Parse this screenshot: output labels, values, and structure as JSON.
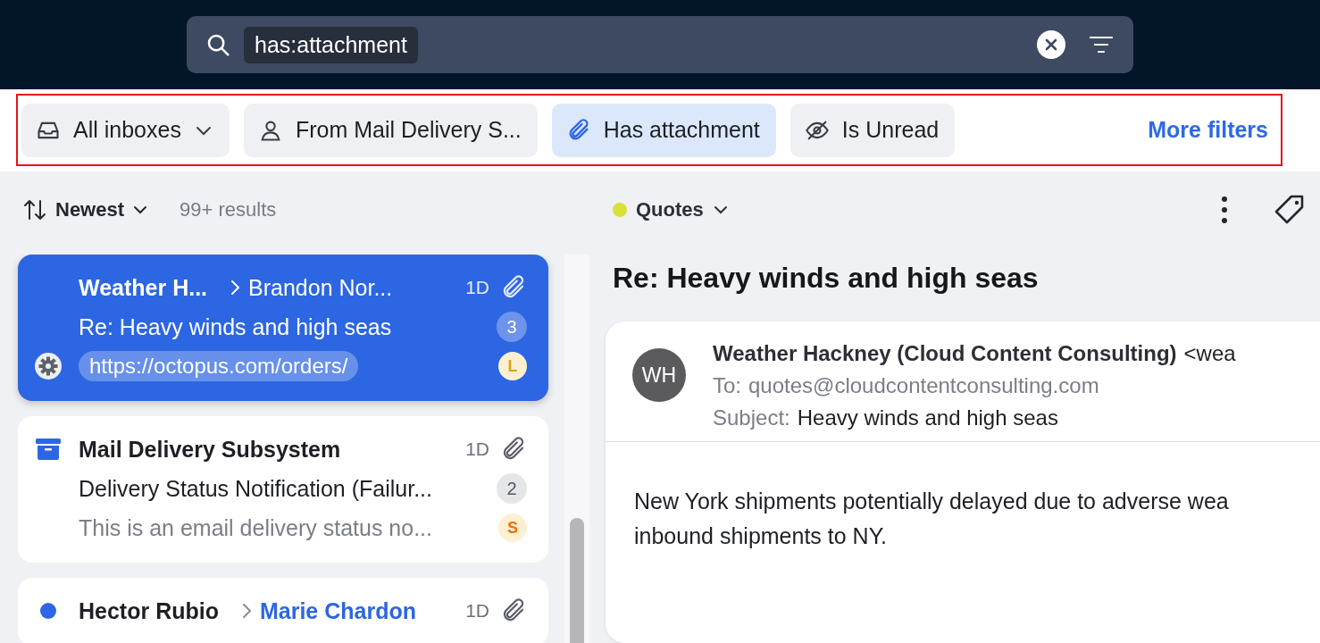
{
  "search": {
    "query": "has:attachment"
  },
  "filters": [
    {
      "label": "All inboxes",
      "selected": false,
      "dropdown": true
    },
    {
      "label": "From Mail Delivery S...",
      "selected": false,
      "dropdown": false
    },
    {
      "label": "Has attachment",
      "selected": true,
      "dropdown": false
    },
    {
      "label": "Is Unread",
      "selected": false,
      "dropdown": false
    }
  ],
  "more_filters": "More filters",
  "sort": {
    "label": "Newest",
    "results": "99+ results"
  },
  "messages": [
    {
      "kind": "automated",
      "selected": true,
      "sender": "Weather H...",
      "recipient": "Brandon Nor...",
      "recipient_highlight": false,
      "time": "1D",
      "attachment": true,
      "subject": "Re: Heavy winds and high seas",
      "count": "3",
      "link": "https://octopus.com/orders/",
      "avatar": "L",
      "color": "#d9a514"
    },
    {
      "kind": "archived",
      "selected": false,
      "sender": "Mail Delivery Subsystem",
      "time": "1D",
      "attachment": true,
      "subject": "Delivery Status Notification (Failur...",
      "count": "2",
      "preview": "This is an email delivery status no...",
      "avatar": "S",
      "color": "#e8730c"
    },
    {
      "kind": "unread",
      "selected": false,
      "sender": "Hector Rubio",
      "recipient": "Marie Chardon",
      "recipient_highlight": true,
      "time": "1D",
      "attachment": true
    }
  ],
  "detail": {
    "label": {
      "name": "Quotes",
      "color": "#d9e03a"
    },
    "title": "Re: Heavy winds and high seas",
    "email": {
      "initials": "WH",
      "from_name": "Weather Hackney (Cloud Content Consulting)",
      "from_address": "<wea",
      "to_label": "To:",
      "to": "quotes@cloudcontentconsulting.com",
      "subject_label": "Subject:",
      "subject": "Heavy winds and high seas",
      "body_lines": [
        "New York shipments potentially delayed due to adverse wea",
        "inbound shipments to NY."
      ]
    }
  }
}
